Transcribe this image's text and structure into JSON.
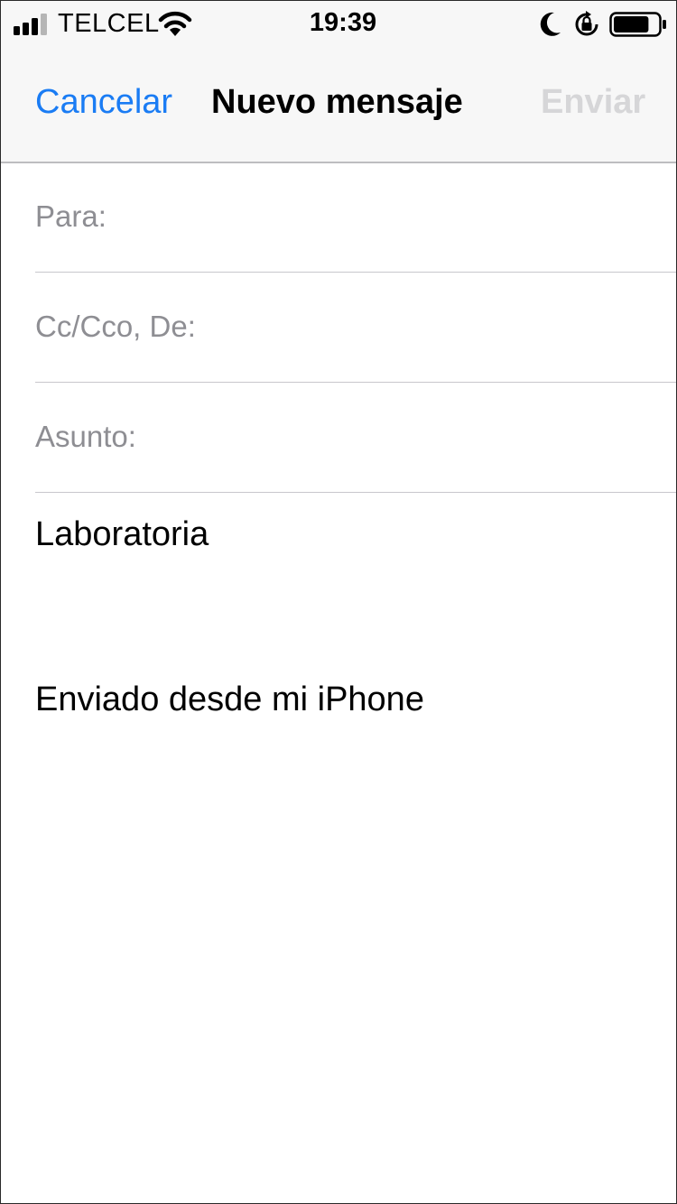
{
  "status_bar": {
    "carrier": "TELCEL",
    "time": "19:39",
    "signal_icon": "cellular-signal-icon",
    "wifi_icon": "wifi-icon",
    "dnd_icon": "moon-icon",
    "rotation_lock_icon": "rotation-lock-icon",
    "battery_icon": "battery-icon",
    "battery_level": 0.8
  },
  "nav": {
    "cancel_label": "Cancelar",
    "title": "Nuevo mensaje",
    "send_label": "Enviar"
  },
  "fields": {
    "to_label": "Para:",
    "cc_label": "Cc/Cco, De:",
    "subject_label": "Asunto:"
  },
  "body": {
    "text": "Laboratoria",
    "signature": "Enviado desde mi iPhone"
  },
  "colors": {
    "accent": "#1a7cf4",
    "disabled": "#d6d6d8",
    "placeholder": "#8e8e93",
    "header_bg": "#f7f7f7",
    "separator": "#c8c7cc"
  }
}
